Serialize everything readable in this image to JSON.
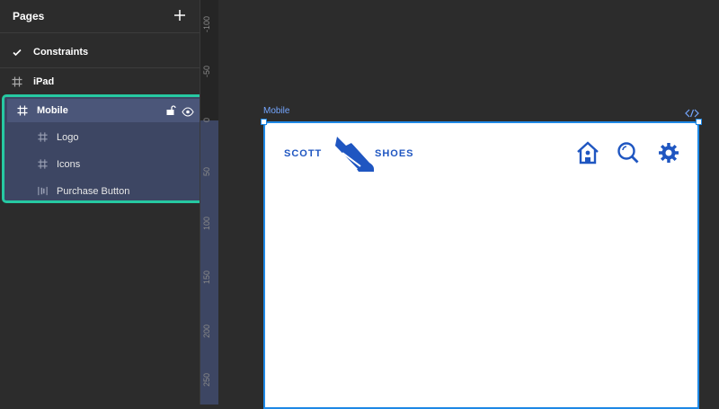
{
  "sidebar": {
    "title": "Pages",
    "pages": [
      {
        "label": "Constraints",
        "icon": "checkmark-icon",
        "current": true
      },
      {
        "label": "iPad",
        "icon": "frame-hash-icon"
      },
      {
        "label": "Mobile",
        "icon": "frame-hash-icon",
        "selected": true
      }
    ],
    "children": [
      {
        "label": "Logo",
        "icon": "frame-hash-icon"
      },
      {
        "label": "Icons",
        "icon": "frame-hash-icon"
      },
      {
        "label": "Purchase Button",
        "icon": "vertical-layout-icon"
      }
    ]
  },
  "ruler": {
    "ticks": [
      "-100",
      "-50",
      "0",
      "50",
      "100",
      "150",
      "200",
      "250"
    ]
  },
  "canvas": {
    "frame_label": "Mobile",
    "logo": {
      "left_text": "SCOTT",
      "right_text": "SHOES"
    },
    "nav_icons": [
      "home-icon",
      "search-icon",
      "gear-icon"
    ]
  },
  "colors": {
    "selection_outline": "#26c9a2",
    "selected_row": "#4b5679",
    "frame_border": "#1e88e5",
    "brand_blue": "#1f56c1"
  }
}
